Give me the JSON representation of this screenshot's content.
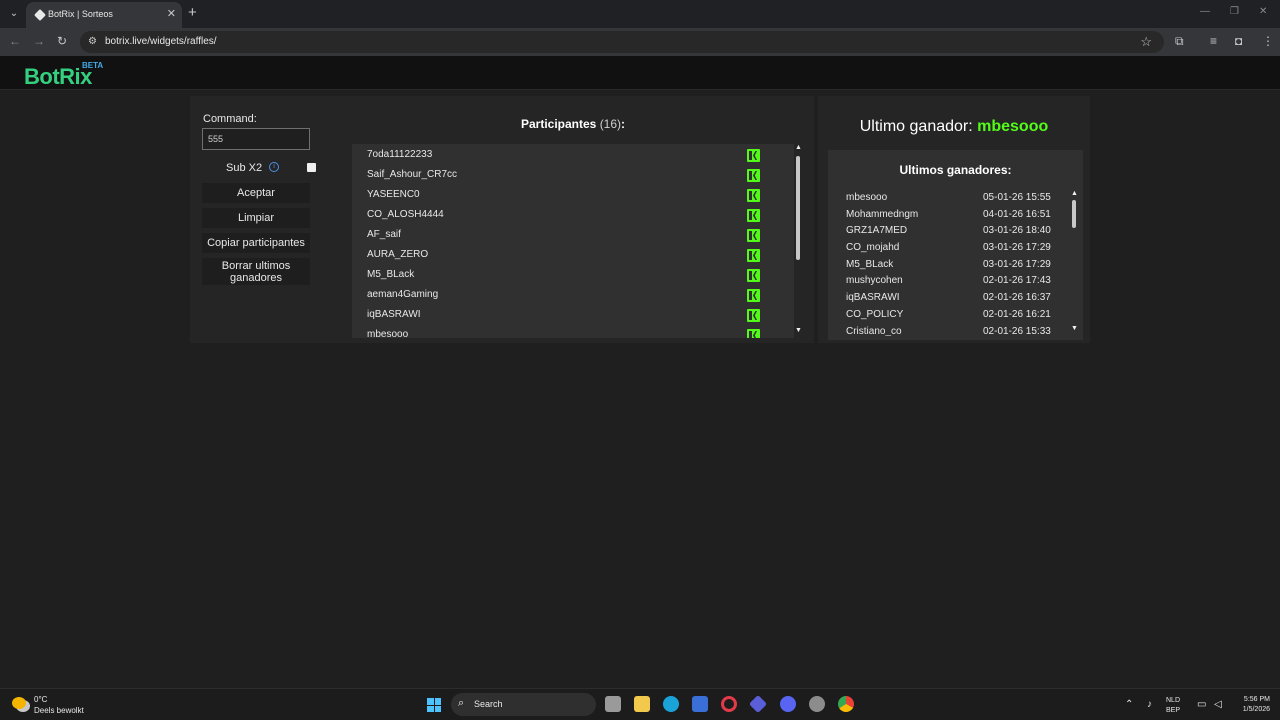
{
  "browser": {
    "tab_title": "BotRix | Sorteos",
    "url": "botrix.live/widgets/raffles/",
    "icons": [
      "tab-search-icon",
      "favicon-icon",
      "close-icon",
      "new-tab-icon",
      "minimize-icon",
      "maximize-icon",
      "window-close-icon",
      "back-icon",
      "forward-icon",
      "reload-icon",
      "site-info-icon",
      "bookmark-star-icon",
      "extensions-icon",
      "media-icon",
      "profile-icon",
      "menu-icon"
    ]
  },
  "site": {
    "logo": "BotRix",
    "logo_badge": "BETA",
    "colors": {
      "brand": "#35d07f",
      "badge": "#41a9e8",
      "kick": "#53fc18"
    }
  },
  "controls": {
    "command_label": "Command:",
    "command_value": "555",
    "sub_label": "Sub X2",
    "sub_checked": false,
    "accept": "Aceptar",
    "clear": "Limpiar",
    "copy": "Copiar participantes",
    "delete_line1": "Borrar ultimos",
    "delete_line2": "ganadores"
  },
  "participants": {
    "title": "Participantes",
    "count": "(16)",
    "colon": ":",
    "items": [
      "7oda11122233",
      "Saif_Ashour_CR7cc",
      "YASEENC0",
      "CO_ALOSH4444",
      "AF_saif",
      "AURA_ZERO",
      "M5_BLack",
      "aeman4Gaming",
      "iqBASRAWI",
      "mbesooo"
    ]
  },
  "winner_panel": {
    "last_label": "Ultimo ganador: ",
    "last_name": "mbesooo",
    "list_title": "Ultimos ganadores:",
    "winners": [
      {
        "name": "mbesooo",
        "date": "05-01-26 15:55"
      },
      {
        "name": "Mohammedngm",
        "date": "04-01-26 16:51"
      },
      {
        "name": "GRZ1A7MED",
        "date": "03-01-26 18:40"
      },
      {
        "name": "CO_mojahd",
        "date": "03-01-26 17:29"
      },
      {
        "name": "M5_BLack",
        "date": "03-01-26 17:29"
      },
      {
        "name": "mushycohen",
        "date": "02-01-26 17:43"
      },
      {
        "name": "iqBASRAWI",
        "date": "02-01-26 16:37"
      },
      {
        "name": "CO_POLICY",
        "date": "02-01-26 16:21"
      },
      {
        "name": "Cristiano_co",
        "date": "02-01-26 15:33"
      }
    ]
  },
  "taskbar": {
    "temp": "0°C",
    "weather": "Deels bewolkt",
    "search": "Search",
    "lang_1": "NLD",
    "lang_2": "BEP",
    "time": "5:56 PM",
    "date": "1/5/2026"
  }
}
